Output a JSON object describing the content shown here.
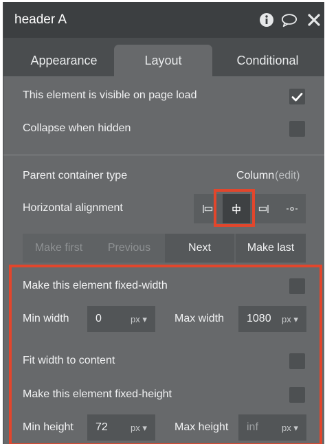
{
  "header": {
    "title": "header A",
    "icons": [
      "info-icon",
      "comment-icon",
      "close-icon"
    ]
  },
  "tabs": [
    {
      "label": "Appearance",
      "active": false
    },
    {
      "label": "Layout",
      "active": true
    },
    {
      "label": "Conditional",
      "active": false
    }
  ],
  "visibility": {
    "visible_on_load_label": "This element is visible on page load",
    "visible_on_load_checked": true,
    "collapse_label": "Collapse when hidden",
    "collapse_checked": false
  },
  "container": {
    "parent_type_label": "Parent container type",
    "parent_type_value": "Column",
    "edit_link": "(edit)",
    "horizontal_alignment_label": "Horizontal alignment",
    "alignment_options": [
      "align-left-icon",
      "align-center-icon",
      "align-right-icon",
      "align-distribute-icon"
    ],
    "selected_alignment": "align-center-icon"
  },
  "order": {
    "make_first": "Make first",
    "previous": "Previous",
    "next": "Next",
    "make_last": "Make last"
  },
  "width": {
    "fixed_width_label": "Make this element fixed-width",
    "fixed_width_checked": false,
    "min_width_label": "Min width",
    "min_width_value": "0",
    "min_width_unit": "px",
    "max_width_label": "Max width",
    "max_width_value": "1080",
    "max_width_unit": "px",
    "fit_width_label": "Fit width to content",
    "fit_width_checked": false
  },
  "height": {
    "fixed_height_label": "Make this element fixed-height",
    "fixed_height_checked": false,
    "min_height_label": "Min height",
    "min_height_value": "72",
    "min_height_unit": "px",
    "max_height_label": "Max height",
    "max_height_placeholder": "inf",
    "max_height_unit": "px"
  },
  "colors": {
    "highlight": "#e2462c",
    "panel": "#67696b",
    "header": "#3c3f41"
  }
}
